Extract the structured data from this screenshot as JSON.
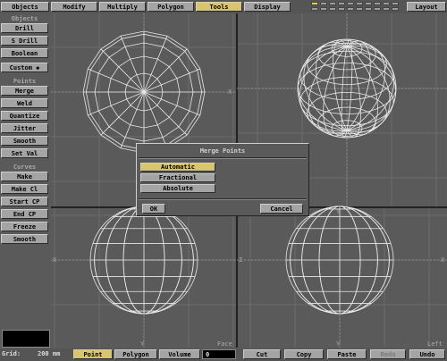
{
  "tabs": [
    {
      "label": "Objects",
      "active": false
    },
    {
      "label": "Modify",
      "active": false
    },
    {
      "label": "Multiply",
      "active": false
    },
    {
      "label": "Polygon",
      "active": false
    },
    {
      "label": "Tools",
      "active": true
    },
    {
      "label": "Display",
      "active": false
    }
  ],
  "layout_button": "Layout",
  "sidebar": {
    "groups": [
      {
        "header": "Objects",
        "items": [
          "Drill",
          "S Drill",
          "Boolean",
          "Custom ◆"
        ]
      },
      {
        "header": "Points",
        "items": [
          "Merge",
          "Weld",
          "Quantize",
          "Jitter",
          "Smooth",
          "Set Val"
        ]
      },
      {
        "header": "Curves",
        "items": [
          "Make",
          "Make Cl",
          "Start CP",
          "End CP",
          "Freeze",
          "Smooth"
        ]
      }
    ]
  },
  "viewports": {
    "axis_labels": [
      "X",
      "Y",
      "Z",
      "X",
      "Y",
      "Z",
      "X",
      "Y"
    ],
    "view_names": [
      "Face",
      "Left"
    ]
  },
  "dialog": {
    "title": "Merge Points",
    "options": [
      {
        "label": "Automatic",
        "selected": true
      },
      {
        "label": "Fractional",
        "selected": false
      },
      {
        "label": "Absolute",
        "selected": false
      }
    ],
    "ok_label": "OK",
    "cancel_label": "Cancel"
  },
  "bottombar": {
    "grid_label": "Grid:",
    "grid_value": "200 mm",
    "modes": [
      {
        "label": "Point",
        "selected": true
      },
      {
        "label": "Polygon",
        "selected": false
      },
      {
        "label": "Volume",
        "selected": false
      }
    ],
    "field_value": "0",
    "actions": [
      {
        "label": "Cut",
        "enabled": true
      },
      {
        "label": "Copy",
        "enabled": true
      },
      {
        "label": "Paste",
        "enabled": true
      },
      {
        "label": "Redo",
        "enabled": false
      },
      {
        "label": "Undo",
        "enabled": true
      }
    ]
  },
  "colors": {
    "background": "#5a5a5a",
    "button": "#a4a4a4",
    "selected": "#d9c56b",
    "wireframe": "#e8e8e8",
    "grid_line": "#6c6c6c"
  }
}
